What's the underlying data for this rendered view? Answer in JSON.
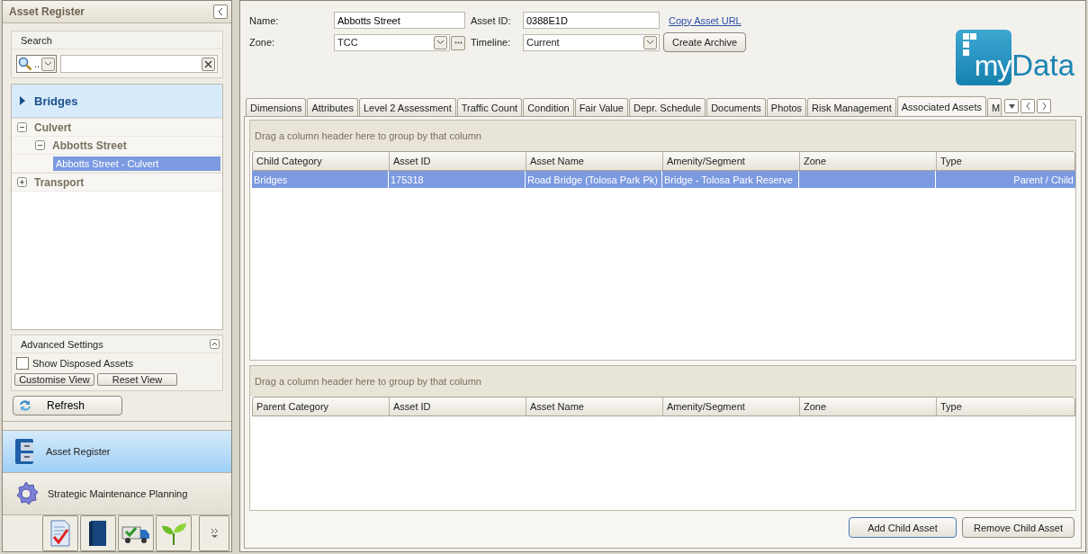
{
  "sidebar": {
    "title": "Asset Register",
    "search": {
      "label": "Search",
      "mode": ".."
    },
    "category": {
      "label": "Bridges",
      "expanded": false
    },
    "tree": [
      {
        "label": "Culvert",
        "expanded": true,
        "selected": false,
        "children": [
          {
            "label": "Abbotts Street",
            "expanded": true,
            "selected": false,
            "children": [
              {
                "label": "Abbotts Street - Culvert",
                "selected": true
              }
            ]
          }
        ]
      },
      {
        "label": "Transport",
        "expanded": false,
        "selected": false
      }
    ],
    "advanced": {
      "title": "Advanced Settings",
      "expanded": true,
      "options": [
        {
          "label": "Show Disposed Assets",
          "checked": false
        }
      ],
      "buttons": [
        "Customise View",
        "Reset View"
      ]
    },
    "refresh": "Refresh",
    "nav": [
      {
        "label": "Asset Register",
        "selected": true
      },
      {
        "label": "Strategic Maintenance Planning",
        "selected": false
      }
    ]
  },
  "form": {
    "name_label": "Name:",
    "name": "Abbotts Street",
    "asset_id_label": "Asset ID:",
    "asset_id": "0388E1D",
    "link": "Copy Asset URL",
    "zone_label": "Zone:",
    "zone": "TCC",
    "timeline_label": "Timeline:",
    "timeline": "Current",
    "archive_button": "Create Archive"
  },
  "logo": {
    "prefix": "my",
    "word": "Data"
  },
  "tabs": [
    {
      "label": "Dimensions",
      "selected": false
    },
    {
      "label": "Attributes",
      "selected": false
    },
    {
      "label": "Level 2 Assessment",
      "selected": false
    },
    {
      "label": "Traffic Count",
      "selected": false
    },
    {
      "label": "Condition",
      "selected": false
    },
    {
      "label": "Fair Value",
      "selected": false
    },
    {
      "label": "Depr. Schedule",
      "selected": false
    },
    {
      "label": "Documents",
      "selected": false
    },
    {
      "label": "Photos",
      "selected": false
    },
    {
      "label": "Risk Management",
      "selected": false
    },
    {
      "label": "Associated Assets",
      "selected": true
    },
    {
      "label": "M",
      "selected": false
    }
  ],
  "grids": [
    {
      "group_hint": "Drag a column header here to group by that column",
      "columns": [
        "Child Category",
        "Asset ID",
        "Asset Name",
        "Amenity/Segment",
        "Zone",
        "Type"
      ],
      "rows": [
        {
          "cells": [
            "Bridges",
            "175318",
            "Road Bridge (Tolosa Park Pk)",
            "Bridge - Tolosa Park Reserve",
            "",
            "Parent / Child"
          ],
          "selected": true
        }
      ]
    },
    {
      "group_hint": "Drag a column header here to group by that column",
      "columns": [
        "Parent Category",
        "Asset ID",
        "Asset Name",
        "Amenity/Segment",
        "Zone",
        "Type"
      ]
    }
  ],
  "buttons": [
    "Add Child Asset",
    "Remove Child Asset"
  ]
}
